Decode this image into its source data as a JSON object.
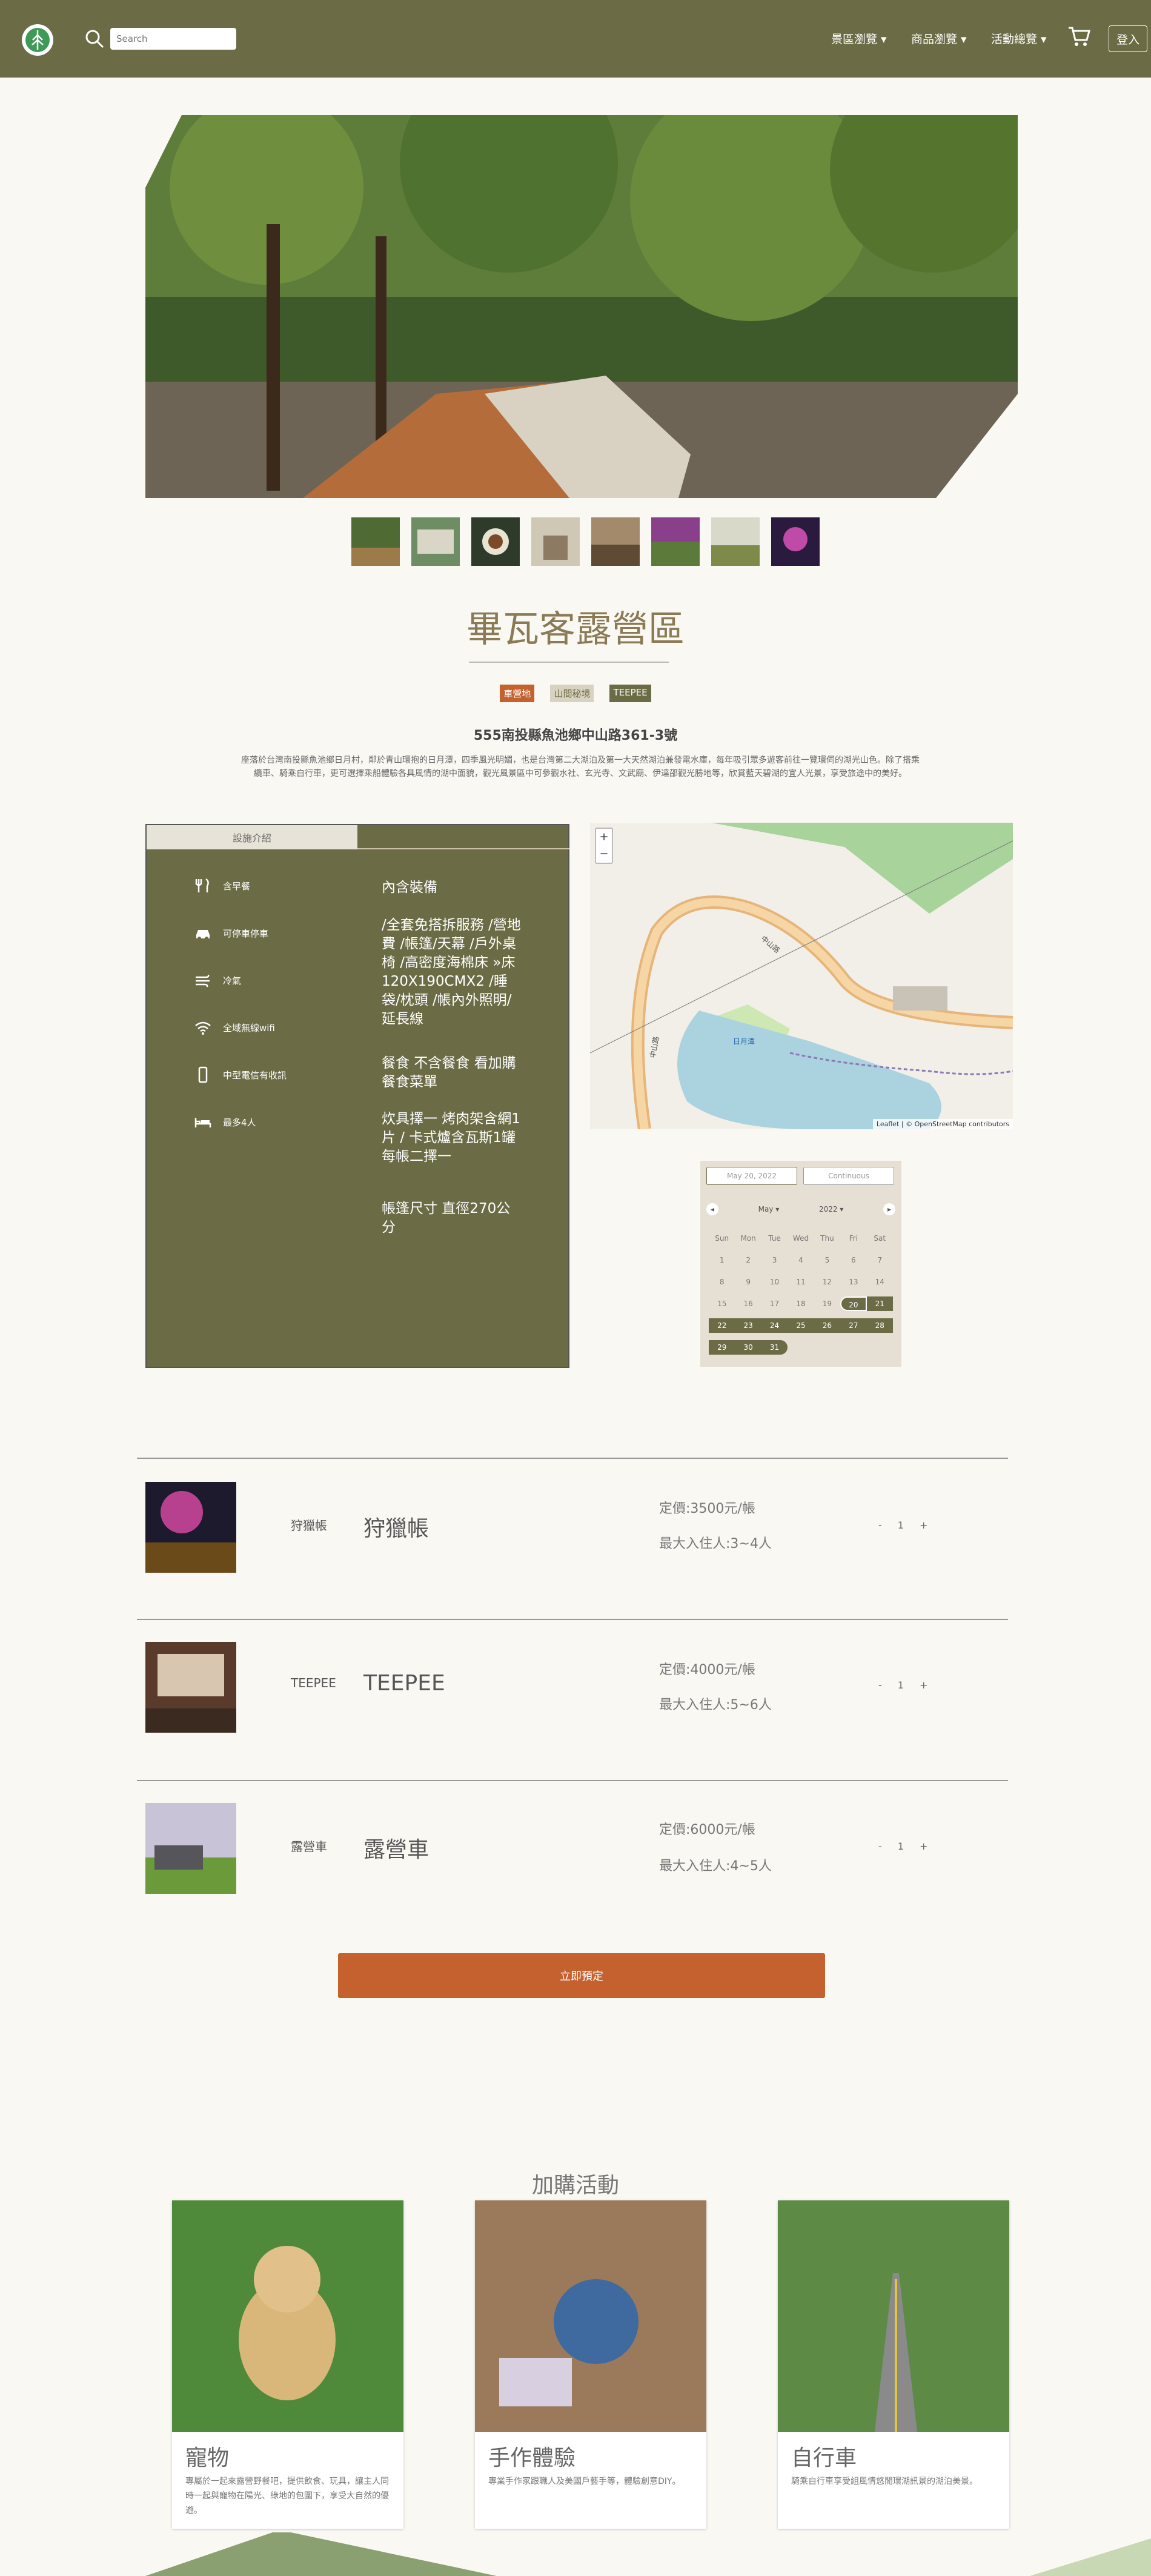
{
  "nav": {
    "search_placeholder": "Search",
    "items": [
      "景區瀏覽",
      "商品瀏覽",
      "活動總覽"
    ],
    "login": "登入"
  },
  "campsite": {
    "title": "畢瓦客露營區",
    "tags": [
      {
        "label": "車營地",
        "color": "#c4612f"
      },
      {
        "label": "山間秘境",
        "color": "#d8d2c0"
      },
      {
        "label": "TEEPEE",
        "color": "#6b6b45"
      }
    ],
    "address": "555南投縣魚池鄉中山路361-3號",
    "description": "座落於台灣南投縣魚池鄉日月村，鄰於青山環抱的日月潭，四季風光明媚，也是台灣第二大湖泊及第一大天然湖泊兼發電水庫，每年吸引眾多遊客前往一覽環伺的湖光山色。除了搭乘纜車、騎乘自行車，更可選擇乘船體驗各具風情的湖中面貌，觀光風景區中可參觀水社、玄光寺、文武廟、伊達邵觀光勝地等，欣賞藍天碧湖的宜人光景，享受旅途中的美好。"
  },
  "info": {
    "tab": "設施介紹",
    "amenities": [
      "含早餐",
      "可停車停車",
      "冷氣",
      "全域無線wifi",
      "中型電信有收訊",
      "最多4人"
    ],
    "paragraphs": [
      "內含裝備",
      "/全套免搭拆服務 /營地費 /帳篷/天幕 /戶外桌椅 /高密度海棉床 »床 120X190CMX2 /睡袋/枕頭 /帳內外照明/延長線",
      "餐食 不含餐食 看加購餐食菜單",
      "炊具擇一 烤肉架含網1片 / 卡式爐含瓦斯1罐 每帳二擇一",
      "帳篷尺寸 直徑270公分"
    ]
  },
  "map": {
    "zoom_in": "+",
    "zoom_out": "−",
    "attribution": "Leaflet | © OpenStreetMap contributors",
    "labels": [
      "中山路",
      "中山路",
      "日月潭"
    ]
  },
  "calendar": {
    "start_date": "May 20, 2022",
    "end_placeholder": "Continuous",
    "month": "May",
    "year": "2022",
    "weekdays": [
      "Sun",
      "Mon",
      "Tue",
      "Wed",
      "Thu",
      "Fri",
      "Sat"
    ],
    "days": [
      "1",
      "2",
      "3",
      "4",
      "5",
      "6",
      "7",
      "8",
      "9",
      "10",
      "11",
      "12",
      "13",
      "14",
      "15",
      "16",
      "17",
      "18",
      "19",
      "20",
      "21",
      "22",
      "23",
      "24",
      "25",
      "26",
      "27",
      "28",
      "29",
      "30",
      "31"
    ],
    "selected_from": 20
  },
  "rooms": [
    {
      "small": "狩獵帳",
      "big": "狩獵帳",
      "price": "定價:3500元/帳",
      "max": "最大入住人:3~4人",
      "qty": "1"
    },
    {
      "small": "TEEPEE",
      "big": "TEEPEE",
      "price": "定價:4000元/帳",
      "max": "最大入住人:5~6人",
      "qty": "1"
    },
    {
      "small": "露營車",
      "big": "露營車",
      "price": "定價:6000元/帳",
      "max": "最大入住人:4~5人",
      "qty": "1"
    }
  ],
  "qty_minus": "-",
  "qty_plus": "+",
  "book_button": "立即預定",
  "addons": {
    "title": "加購活動",
    "cards": [
      {
        "title": "寵物",
        "desc": "專屬於一起來露營野餐吧，提供飲食、玩具，讓主人同時一起與寵物在陽光、綠地的包圍下，享受大自然的優遊。"
      },
      {
        "title": "手作體驗",
        "desc": "專業手作家跟職人及美國戶藝手等，體驗創意DIY。"
      },
      {
        "title": "自行車",
        "desc": "騎乘自行車享受組風情悠閒環湖訊景的湖泊美景。"
      }
    ]
  },
  "colors": {
    "nav": "#6b6b45",
    "accent": "#c4612f",
    "card_bg": "#ffffff"
  }
}
